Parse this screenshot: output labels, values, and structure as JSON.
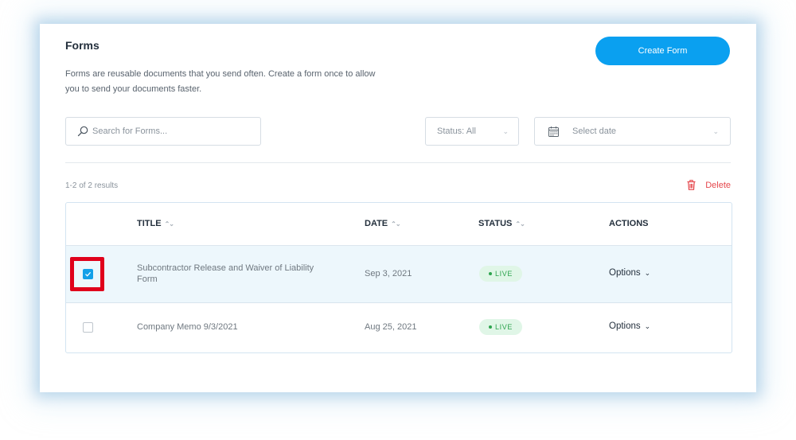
{
  "page": {
    "title": "Forms",
    "description": "Forms are reusable documents that you send often. Create a form once to allow you to send your documents faster.",
    "create_button": "Create Form"
  },
  "filters": {
    "search_placeholder": "Search for Forms...",
    "search_value": "",
    "status_label": "Status: All",
    "date_placeholder": "Select date"
  },
  "results_summary": "1-2 of 2 results",
  "delete_label": "Delete",
  "table": {
    "headers": {
      "title": "TITLE",
      "date": "DATE",
      "status": "STATUS",
      "actions": "ACTIONS"
    },
    "rows": [
      {
        "checked": true,
        "title": "Subcontractor Release and Waiver of Liability Form",
        "date": "Sep 3, 2021",
        "status": "LIVE",
        "action": "Options"
      },
      {
        "checked": false,
        "title": "Company Memo 9/3/2021",
        "date": "Aug 25, 2021",
        "status": "LIVE",
        "action": "Options"
      }
    ]
  },
  "colors": {
    "accent": "#0aa0f0",
    "delete": "#e5484d",
    "live_badge_bg": "#e0f6e7",
    "live_badge_text": "#2da44e",
    "selected_row_bg": "#edf7fc",
    "annotation_highlight": "#e0001b"
  },
  "icons": {
    "search": "search-icon",
    "calendar": "calendar-icon",
    "trash": "trash-icon",
    "sort": "sort-icon",
    "chevron": "chevron-down-icon",
    "check": "check-icon"
  }
}
